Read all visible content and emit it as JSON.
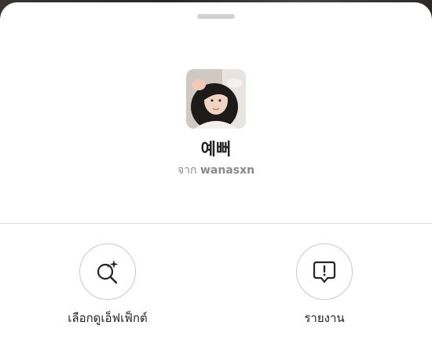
{
  "effect": {
    "name": "예뻐",
    "creator_prefix": "จาก",
    "creator_handle": "wanasxn"
  },
  "actions": [
    {
      "label": "เลือกดูเอ็ฟเฟ็กต์",
      "icon": "sparkle-search-icon"
    },
    {
      "label": "รายงาน",
      "icon": "report-alert-icon"
    }
  ],
  "colors": {
    "sheet_background": "#ffffff",
    "grabber": "#d1d1d1",
    "primary_text": "#222222",
    "secondary_text": "#8a8a8a",
    "divider": "#dcdcdc",
    "circle_border": "#c9c9c9"
  }
}
